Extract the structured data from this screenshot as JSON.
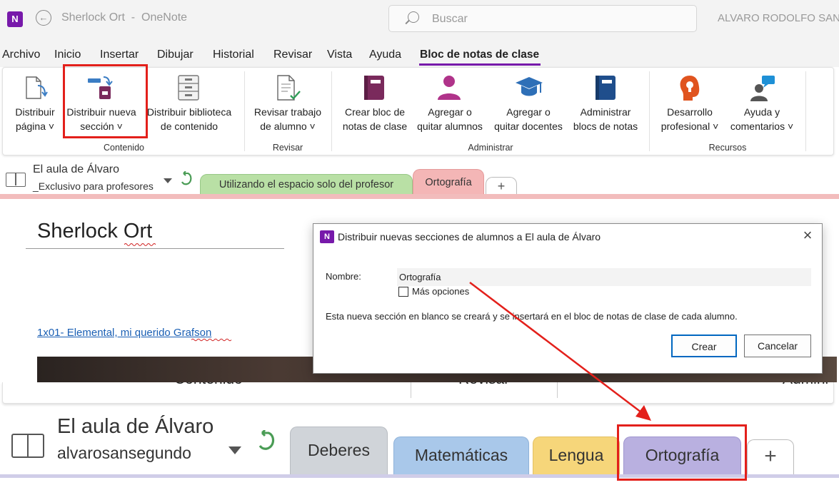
{
  "titlebar": {
    "logo": "N",
    "back_icon": "back-arrow-icon",
    "title": "Sherlock Ort  -  OneNote",
    "search_placeholder": "Buscar",
    "user": "ALVARO RODOLFO SAN"
  },
  "menu": {
    "items": [
      "Archivo",
      "Inicio",
      "Insertar",
      "Dibujar",
      "Historial",
      "Revisar",
      "Vista",
      "Ayuda",
      "Bloc de notas de clase"
    ],
    "active": "Bloc de notas de clase",
    "active_color": "#7719aa"
  },
  "ribbon": {
    "buttons": {
      "distribuir_pagina": [
        "Distribuir",
        "página ˅"
      ],
      "distribuir_seccion": [
        "Distribuir nueva",
        "sección ˅"
      ],
      "distribuir_biblioteca": [
        "Distribuir biblioteca",
        "de contenido"
      ],
      "revisar_trabajo": [
        "Revisar trabajo",
        "de alumno ˅"
      ],
      "crear_bloc": [
        "Crear bloc de",
        "notas de clase"
      ],
      "agregar_alumnos": [
        "Agregar o",
        "quitar alumnos"
      ],
      "agregar_docentes": [
        "Agregar o",
        "quitar docentes"
      ],
      "administrar_blocs": [
        "Administrar",
        "blocs de notas"
      ],
      "desarrollo": [
        "Desarrollo",
        "profesional ˅"
      ],
      "ayuda": [
        "Ayuda y",
        "comentarios ˅"
      ]
    },
    "groups": {
      "contenido": "Contenido",
      "revisar": "Revisar",
      "administrar": "Administrar",
      "recursos": "Recursos"
    },
    "highlight_color": "#e3201b"
  },
  "upper_tabs": {
    "notebook_name": "El aula de Álvaro",
    "section_group": "_Exclusivo para profesores",
    "tabs": [
      "Utilizando el espacio solo del profesor",
      "Ortografía",
      "+"
    ],
    "tab_colors": [
      "#b9e0a5",
      "#f4b6b6",
      "#ffffff"
    ]
  },
  "page": {
    "title": "Sherlock Ort",
    "link": "1x01- Elemental, mi querido Grafson"
  },
  "dialog": {
    "title": "Distribuir nuevas secciones de alumnos a El aula de Álvaro",
    "name_label": "Nombre:",
    "name_value": "Ortografía",
    "more_options": "Más opciones",
    "description": "Esta nueva sección en blanco se creará y se insertará en el bloc de notas de clase de cada alumno.",
    "create_label": "Crear",
    "cancel_label": "Cancelar"
  },
  "lower_zoom": {
    "cut_labels": [
      "Contenido",
      "Revisar",
      "Admini"
    ],
    "notebook_name": "El aula de Álvaro",
    "owner": "alvarosansegundo",
    "tabs": [
      "Deberes",
      "Matemáticas",
      "Lengua",
      "Ortografía",
      "+"
    ],
    "tab_colors": [
      "#d0d4d9",
      "#a9c8ea",
      "#f6d67a",
      "#b9b0e0",
      "#ffffff"
    ]
  }
}
